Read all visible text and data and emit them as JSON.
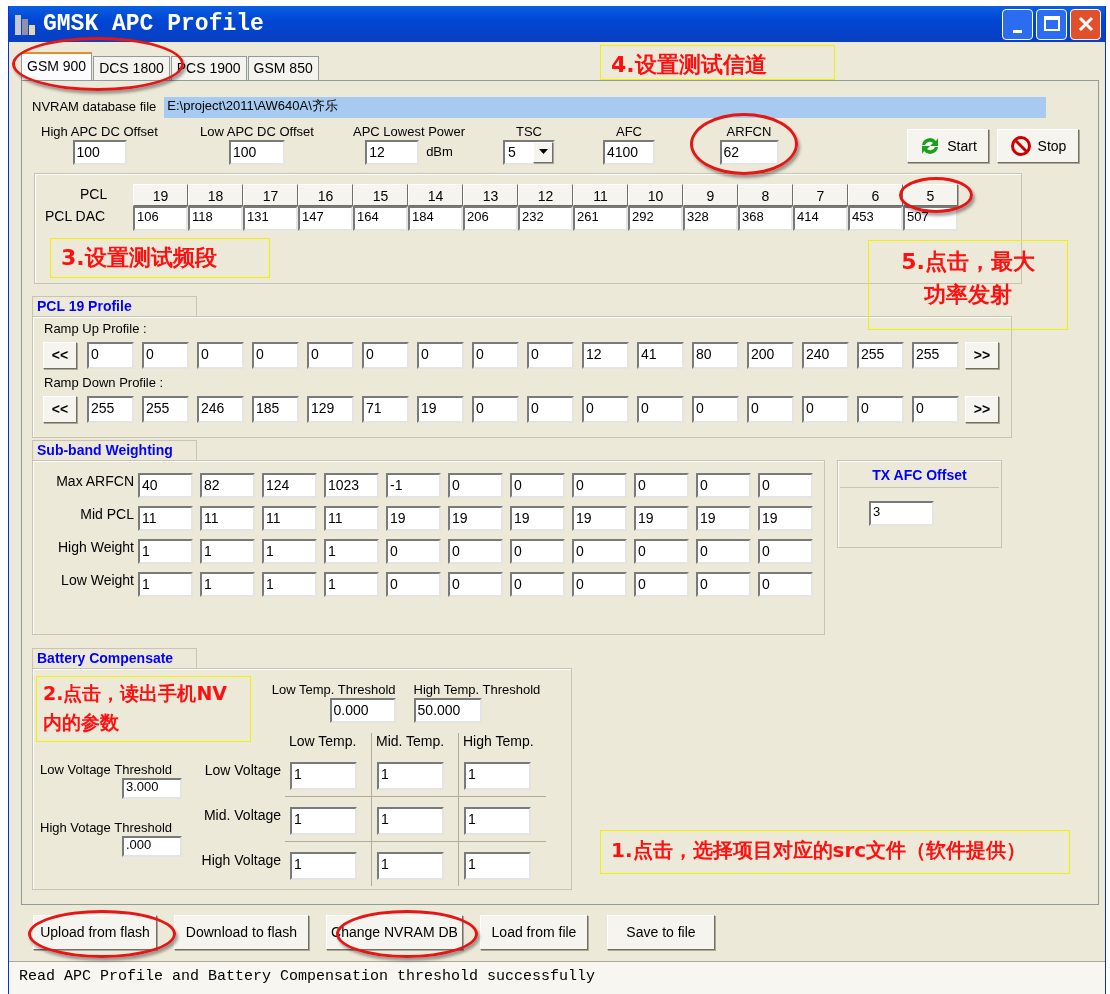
{
  "window": {
    "title": "GMSK APC Profile"
  },
  "tabs": [
    {
      "label": "GSM 900",
      "selected": true
    },
    {
      "label": "DCS 1800",
      "selected": false
    },
    {
      "label": "PCS 1900",
      "selected": false
    },
    {
      "label": "GSM 850",
      "selected": false
    }
  ],
  "nvram": {
    "label": "NVRAM database file",
    "value": "E:\\project\\2011\\AW640A\\齐乐"
  },
  "settings": [
    {
      "kind": "field",
      "label": "High APC DC Offset",
      "value": "100"
    },
    {
      "kind": "field",
      "label": "Low APC DC Offset",
      "value": "100"
    },
    {
      "kind": "field",
      "label": "APC Lowest Power",
      "value": "12",
      "unit": "dBm"
    },
    {
      "kind": "dropdown",
      "label": "TSC",
      "value": "5"
    },
    {
      "kind": "field",
      "label": "AFC",
      "value": "4100"
    },
    {
      "kind": "field",
      "label": "ARFCN",
      "value": "62"
    }
  ],
  "actions": [
    {
      "kind": "run",
      "label": "Start"
    },
    {
      "kind": "stop",
      "label": "Stop"
    }
  ],
  "pcl": {
    "header_label": "PCL",
    "value_label": "PCL DAC",
    "levels": [
      "19",
      "18",
      "17",
      "16",
      "15",
      "14",
      "13",
      "12",
      "11",
      "10",
      "9",
      "8",
      "7",
      "6",
      "5"
    ],
    "dac": [
      "106",
      "118",
      "131",
      "147",
      "164",
      "184",
      "206",
      "232",
      "261",
      "292",
      "328",
      "368",
      "414",
      "453",
      "507"
    ]
  },
  "profile": {
    "title": "PCL 19 Profile",
    "rows": [
      {
        "label": "Ramp Up Profile :",
        "prev": "<<",
        "next": ">>",
        "values": [
          "0",
          "0",
          "0",
          "0",
          "0",
          "0",
          "0",
          "0",
          "0",
          "12",
          "41",
          "80",
          "200",
          "240",
          "255",
          "255"
        ]
      },
      {
        "label": "Ramp Down Profile :",
        "prev": "<<",
        "next": ">>",
        "values": [
          "255",
          "255",
          "246",
          "185",
          "129",
          "71",
          "19",
          "0",
          "0",
          "0",
          "0",
          "0",
          "0",
          "0",
          "0",
          "0"
        ]
      }
    ]
  },
  "subband": {
    "title": "Sub-band Weighting",
    "rows": [
      {
        "label": "Max ARFCN",
        "values": [
          "40",
          "82",
          "124",
          "1023",
          "-1",
          "0",
          "0",
          "0",
          "0",
          "0",
          "0"
        ]
      },
      {
        "label": "Mid PCL",
        "values": [
          "11",
          "11",
          "11",
          "11",
          "19",
          "19",
          "19",
          "19",
          "19",
          "19",
          "19"
        ]
      },
      {
        "label": "High Weight",
        "values": [
          "1",
          "1",
          "1",
          "1",
          "0",
          "0",
          "0",
          "0",
          "0",
          "0",
          "0"
        ]
      },
      {
        "label": "Low Weight",
        "values": [
          "1",
          "1",
          "1",
          "1",
          "0",
          "0",
          "0",
          "0",
          "0",
          "0",
          "0"
        ]
      }
    ]
  },
  "tx_afc": {
    "title": "TX AFC Offset",
    "value": "3"
  },
  "battery": {
    "title": "Battery Compensate",
    "thresholds": [
      {
        "label": "Low Temp. Threshold",
        "value": "0.000"
      },
      {
        "label": "High Temp. Threshold",
        "value": "50.000"
      }
    ],
    "columns": [
      "Low Temp.",
      "Mid. Temp.",
      "High Temp."
    ],
    "rows": [
      {
        "label": "Low Voltage",
        "values": [
          "1",
          "1",
          "1"
        ]
      },
      {
        "label": "Mid. Voltage",
        "values": [
          "1",
          "1",
          "1"
        ]
      },
      {
        "label": "High Voltage",
        "values": [
          "1",
          "1",
          "1"
        ]
      }
    ],
    "voltage_thresholds": [
      {
        "label": "Low Voltage Threshold",
        "value": "3.000"
      },
      {
        "label": "High Votage Threshold",
        "value": ".000"
      }
    ]
  },
  "buttons": [
    "Upload from flash",
    "Download to flash",
    "Change NVRAM DB",
    "Load from file",
    "Save to file"
  ],
  "status_bar": "Read APC Profile and Battery Compensation threshold successfully",
  "annotations": [
    {
      "kind": "ring"
    },
    {
      "kind": "ring"
    },
    {
      "kind": "ring"
    },
    {
      "kind": "ring"
    },
    {
      "kind": "ring"
    },
    {
      "kind": "callout",
      "text": "3.设置测试频段"
    },
    {
      "kind": "callout",
      "text": "4.设置测试信道"
    },
    {
      "kind": "callout",
      "text": "5.点击，最大功率发射"
    },
    {
      "kind": "callout",
      "text": "2.点击，读出手机NV内的参数"
    },
    {
      "kind": "callout",
      "text": "1.点击，选择项目对应的src文件（软件提供）"
    }
  ]
}
